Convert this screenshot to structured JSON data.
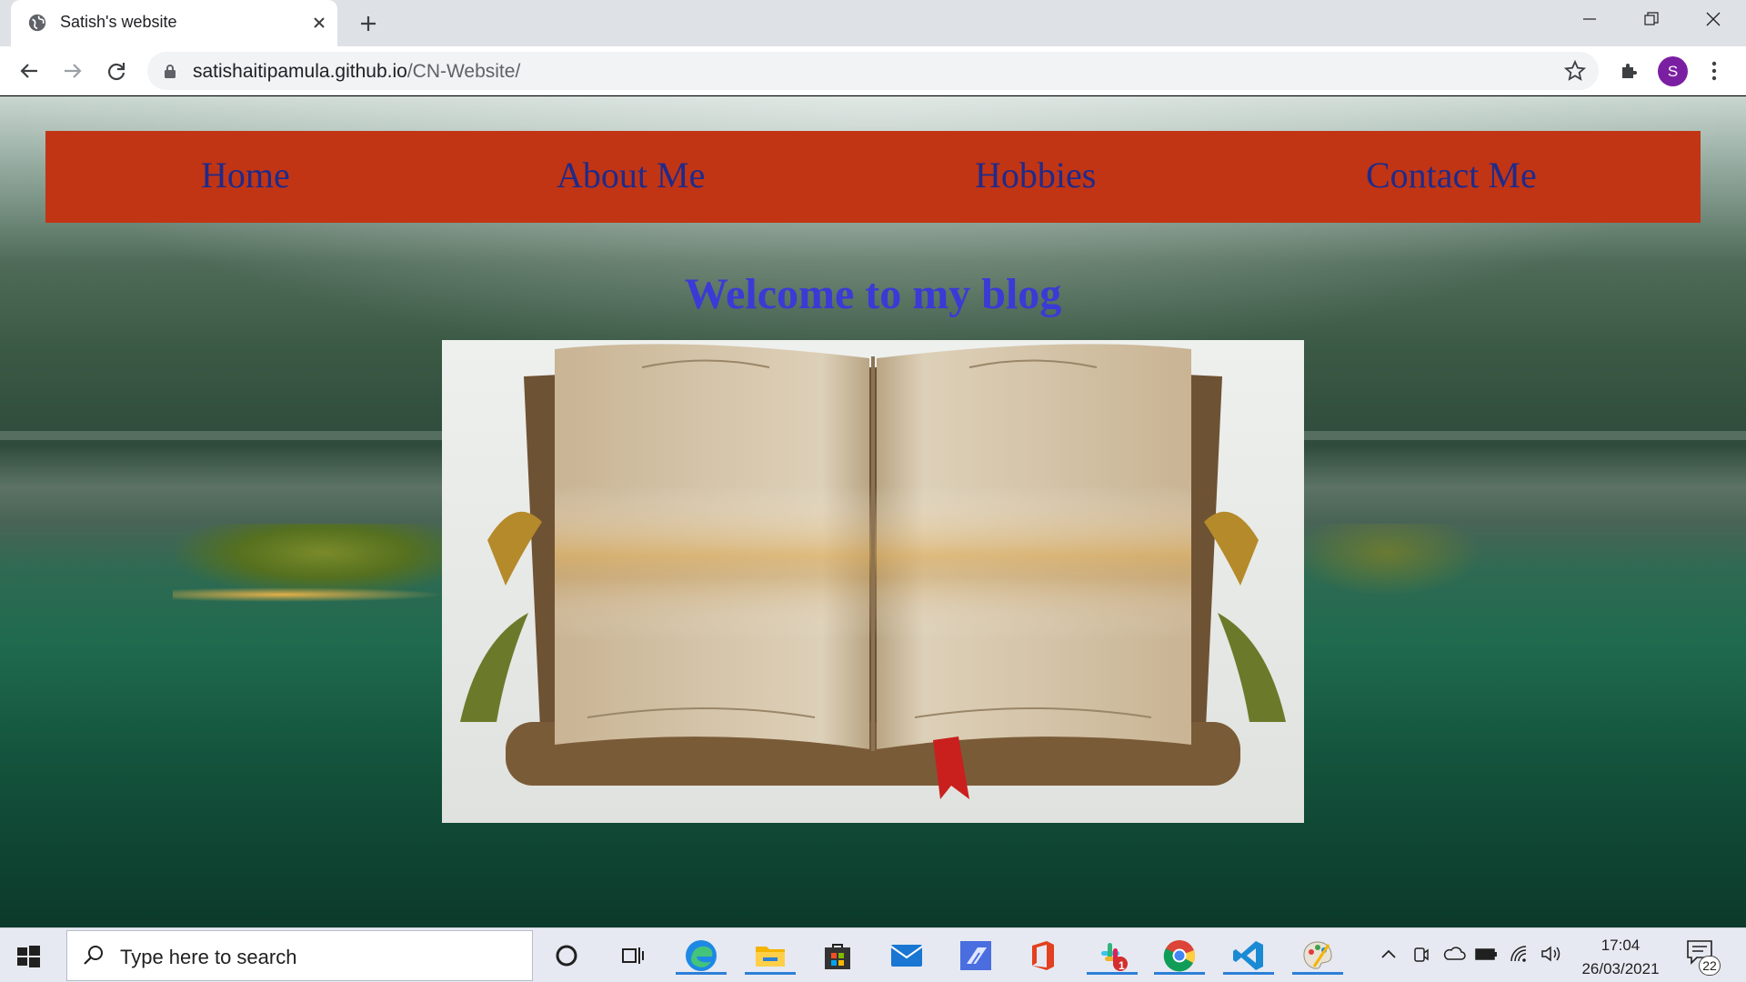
{
  "browser": {
    "tab_title": "Satish's website",
    "url_host": "satishaitipamula.github.io",
    "url_path": "/CN-Website/",
    "profile_initial": "S"
  },
  "page": {
    "nav": [
      "Home",
      "About Me",
      "Hobbies",
      "Contact Me"
    ],
    "welcome": "Welcome to my blog",
    "image": "open-book-image"
  },
  "colors": {
    "navbar": "#c13514",
    "nav_link": "#1f2a8a",
    "heading": "#3a3ad6",
    "avatar": "#7b1fa2"
  },
  "taskbar": {
    "search_placeholder": "Type here to search",
    "time": "17:04",
    "date": "26/03/2021",
    "notification_count": "22",
    "slack_badge": "1",
    "apps": [
      "cortana",
      "task-view",
      "edge",
      "file-explorer",
      "store",
      "mail",
      "power-automate",
      "office",
      "slack",
      "chrome",
      "vscode",
      "paint-3d"
    ]
  }
}
